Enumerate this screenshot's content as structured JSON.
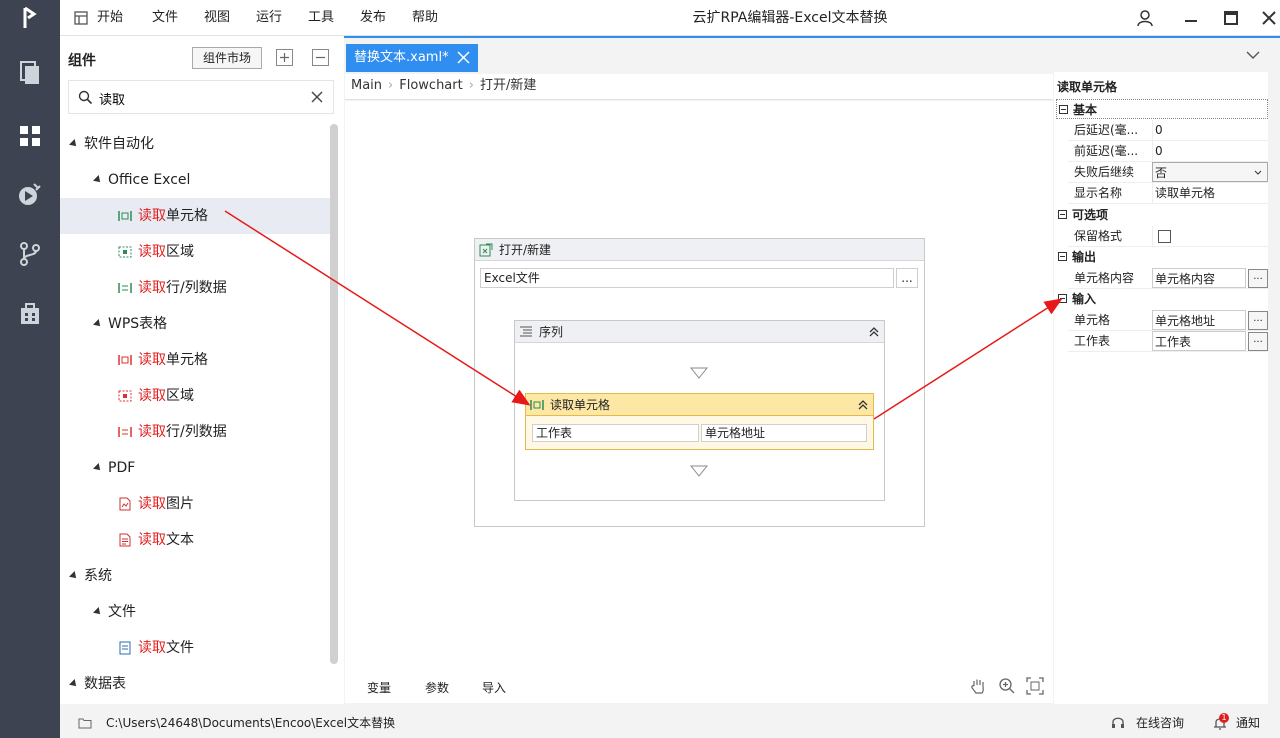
{
  "app": {
    "title": "云扩RPA编辑器-Excel文本替换"
  },
  "menu": [
    {
      "label": "开始"
    },
    {
      "label": "文件"
    },
    {
      "label": "视图"
    },
    {
      "label": "运行"
    },
    {
      "label": "工具"
    },
    {
      "label": "发布"
    },
    {
      "label": "帮助"
    }
  ],
  "left_panel": {
    "title": "组件",
    "market_button": "组件市场",
    "search_value": "读取",
    "tree": [
      {
        "text": "软件自动化"
      },
      {
        "text": "Office Excel"
      },
      {
        "hl": "读取",
        "rest": "单元格"
      },
      {
        "hl": "读取",
        "rest": "区域"
      },
      {
        "hl": "读取",
        "rest": "行/列数据"
      },
      {
        "text": "WPS表格"
      },
      {
        "hl": "读取",
        "rest": "单元格"
      },
      {
        "hl": "读取",
        "rest": "区域"
      },
      {
        "hl": "读取",
        "rest": "行/列数据"
      },
      {
        "text": "PDF"
      },
      {
        "hl": "读取",
        "rest": "图片"
      },
      {
        "hl": "读取",
        "rest": "文本"
      },
      {
        "text": "系统"
      },
      {
        "text": "文件"
      },
      {
        "hl": "读取",
        "rest": "文件"
      },
      {
        "text": "数据表"
      }
    ]
  },
  "editor": {
    "tab_label": "替换文本.xaml*",
    "breadcrumb": [
      "Main",
      "Flowchart",
      "打开/新建"
    ],
    "open_activity": {
      "title": "打开/新建",
      "field": "Excel文件",
      "browse": "..."
    },
    "sequence": {
      "title": "序列"
    },
    "read_cell": {
      "title": "读取单元格",
      "sheet": "工作表",
      "cell_addr": "单元格地址"
    },
    "footer": [
      "变量",
      "参数",
      "导入"
    ]
  },
  "properties": {
    "header": "读取单元格",
    "sections": {
      "basic": {
        "label": "基本"
      },
      "optional": {
        "label": "可选项"
      },
      "output": {
        "label": "输出"
      },
      "input": {
        "label": "输入"
      }
    },
    "rows": {
      "delay_after": {
        "key": "后延迟(毫...",
        "value": "0"
      },
      "delay_before": {
        "key": "前延迟(毫...",
        "value": "0"
      },
      "continue_on_error": {
        "key": "失败后继续",
        "value": "否"
      },
      "display_name": {
        "key": "显示名称",
        "value": "读取单元格"
      },
      "keep_format": {
        "key": "保留格式",
        "value": ""
      },
      "cell_content": {
        "key": "单元格内容",
        "value": "单元格内容"
      },
      "cell": {
        "key": "单元格",
        "value": "单元格地址"
      },
      "sheet": {
        "key": "工作表",
        "value": "工作表"
      }
    }
  },
  "status": {
    "path": "C:\\Users\\24648\\Documents\\Encoo\\Excel文本替换",
    "consult": "在线咨询",
    "notify": "通知",
    "notify_count": "1"
  },
  "colors": {
    "accent": "#2f8ef0",
    "rail": "#3d4350",
    "highlight": "#e02020",
    "arrow": "#e81818"
  }
}
